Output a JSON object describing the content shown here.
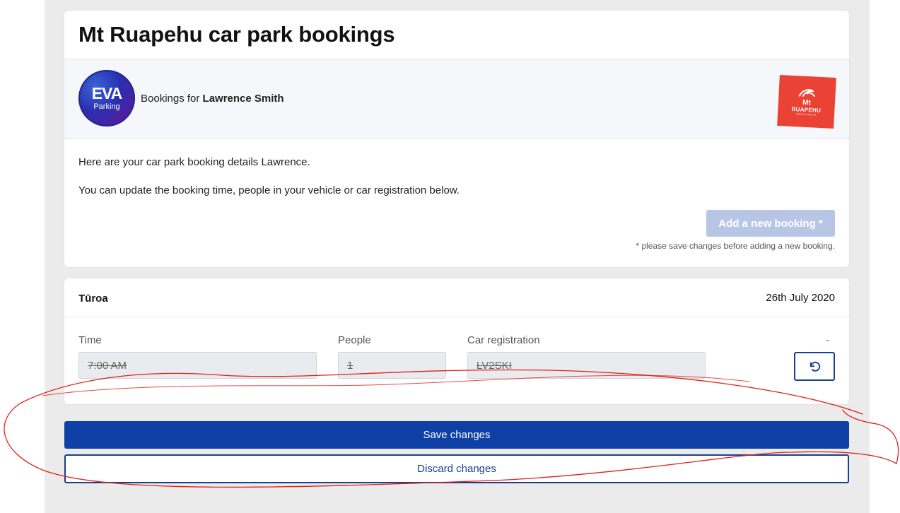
{
  "page": {
    "title": "Mt Ruapehu car park bookings"
  },
  "header": {
    "eva_logo_word": "EVA",
    "eva_logo_sub": "Parking",
    "bookings_for_prefix": "Bookings for ",
    "user_name": "Lawrence Smith",
    "ruapehu_logo_mt": "Mt",
    "ruapehu_logo_name": "RUAPEHU",
    "ruapehu_logo_sub": "NORTH ISLAND, NZ"
  },
  "intro": {
    "line1": "Here are your car park booking details Lawrence.",
    "line2": "You can update the booking time, people in your vehicle or car registration below.",
    "add_button": "Add a new booking *",
    "add_note": "* please save changes before adding a new booking."
  },
  "booking": {
    "location": "Tūroa",
    "date": "26th July 2020",
    "time_label": "Time",
    "time_value": "7:00 AM",
    "people_label": "People",
    "people_value": "1",
    "car_label": "Car registration",
    "car_value": "LV2SKI",
    "status_dash": "-",
    "undo_icon": "undo-icon"
  },
  "actions": {
    "save_label": "Save changes",
    "discard_label": "Discard changes"
  },
  "colors": {
    "primary": "#0e40a5",
    "disabled_button": "#b8c6e6",
    "annotation_red": "#e0201a",
    "ruapehu_red": "#ea4235"
  }
}
